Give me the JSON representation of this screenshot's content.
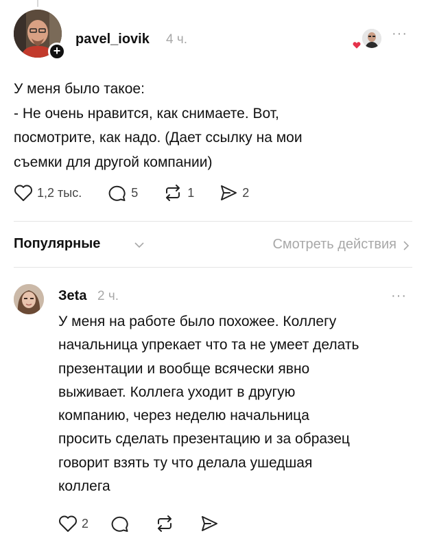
{
  "post": {
    "author": "pavel_iovik",
    "time": "4 ч.",
    "text_lines": [
      "У меня было такое:",
      "- Не очень нравится, как снимаете. Вот,",
      "посмотрите, как надо. (Дает ссылку на мои",
      "съемки для другой компании)"
    ],
    "likes": "1,2 тыс.",
    "comments": "5",
    "reposts": "1",
    "shares": "2",
    "more": "···",
    "follow": "+"
  },
  "sort": {
    "label": "Популярные",
    "view_activity": "Смотреть действия"
  },
  "reply": {
    "author": "Зeta",
    "time": "2 ч.",
    "text_lines": [
      "У меня на работе было похожее. Коллегу",
      "начальница упрекает что та не умеет делать",
      "презентации и вообще всячески явно",
      "выживает. Коллега уходит в другую",
      "компанию, через неделю начальница",
      "просить сделать презентацию и за образец",
      "говорит взять ту что делала ушедшая",
      "коллега"
    ],
    "likes": "2",
    "more": "···"
  },
  "colors": {
    "heart_red": "#e5334b",
    "muted": "#a8a8a8",
    "text": "#111111"
  }
}
